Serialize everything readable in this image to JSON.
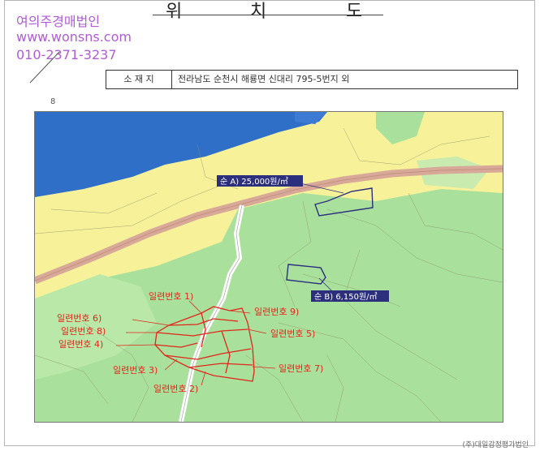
{
  "header": {
    "title_chars": [
      "위",
      "치",
      "도"
    ]
  },
  "watermark": {
    "company": "여의주경매법인",
    "website": "www.wonsns.com",
    "phone": "010-2371-3237",
    "color": "#b15cd6"
  },
  "address": {
    "label": "소 재 지",
    "value": "전라남도 순천시 해룡면 신대리 795-5번지 외"
  },
  "map": {
    "corner_mark": "8",
    "price_labels": [
      {
        "text": "순 A) 25,000원/㎡"
      },
      {
        "text": "순 B) 6,150원/㎡"
      }
    ],
    "lot_labels": [
      {
        "text": "일련번호 1)"
      },
      {
        "text": "일련번호 6)"
      },
      {
        "text": "일련번호 8)"
      },
      {
        "text": "일련번호 4)"
      },
      {
        "text": "일련번호 3)"
      },
      {
        "text": "일련번호 2)"
      },
      {
        "text": "일련번호 9)"
      },
      {
        "text": "일련번호 5)"
      },
      {
        "text": "일련번호 7)"
      }
    ],
    "colors": {
      "sea": "#2f6fc8",
      "urban": "#f7f299",
      "green": "#a9e19c",
      "road": "#d8a999",
      "lot_outline": "#e1261c",
      "price_box": "#2c2f7e"
    }
  },
  "footer": {
    "text": "(주)대일감정평가법인"
  }
}
